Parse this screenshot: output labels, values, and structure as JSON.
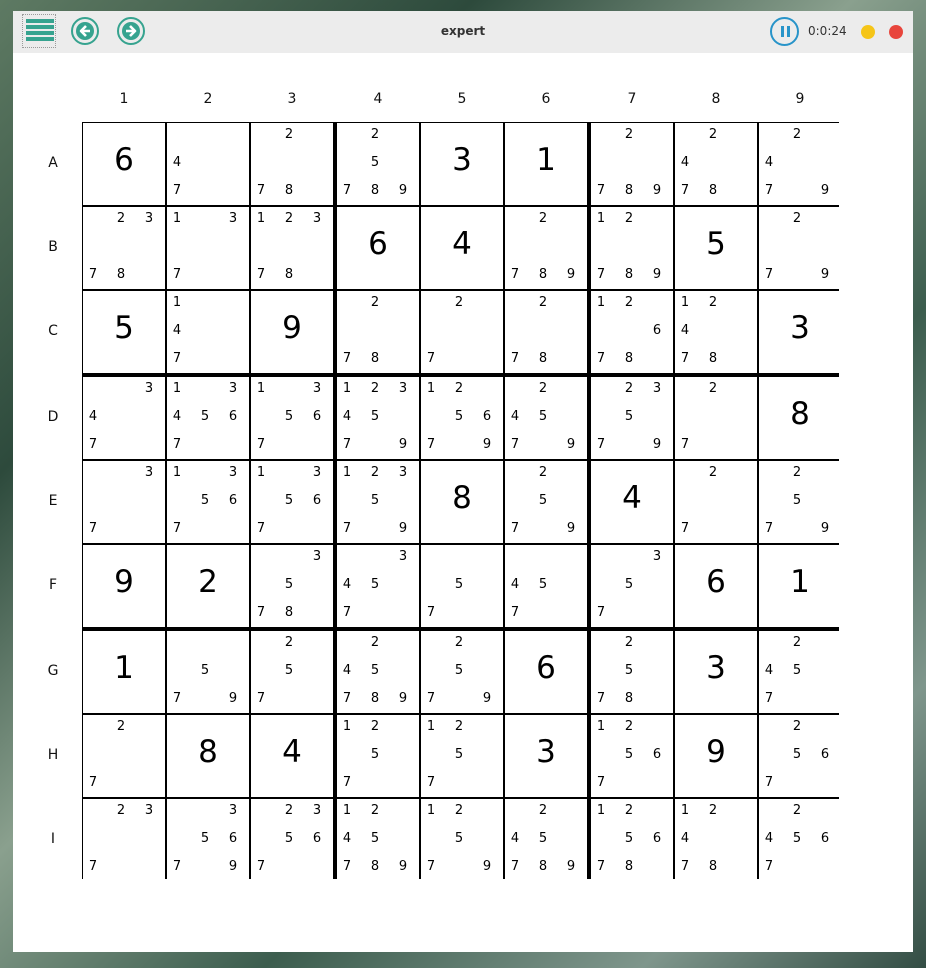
{
  "title": "expert",
  "timer": "0:0:24",
  "colors": {
    "accent": "#36a38f",
    "pause": "#2894c9",
    "minimize": "#f5c518",
    "close": "#e8453c"
  },
  "toolbar": {
    "menu_icon": "hamburger-icon",
    "back_icon": "arrow-left-icon",
    "forward_icon": "arrow-right-icon",
    "pause_icon": "pause-icon"
  },
  "columns": [
    "1",
    "2",
    "3",
    "4",
    "5",
    "6",
    "7",
    "8",
    "9"
  ],
  "rows": [
    "A",
    "B",
    "C",
    "D",
    "E",
    "F",
    "G",
    "H",
    "I"
  ],
  "board": [
    [
      "6",
      [
        4,
        7
      ],
      [
        2,
        7,
        8
      ],
      [
        2,
        5,
        7,
        8,
        9
      ],
      "3",
      "1",
      [
        2,
        7,
        8,
        9
      ],
      [
        2,
        4,
        7,
        8
      ],
      [
        2,
        4,
        7,
        9
      ]
    ],
    [
      [
        2,
        3,
        7,
        8
      ],
      [
        1,
        3,
        7
      ],
      [
        1,
        2,
        3,
        7,
        8
      ],
      "6",
      "4",
      [
        2,
        7,
        8,
        9
      ],
      [
        1,
        2,
        7,
        8,
        9
      ],
      "5",
      [
        2,
        7,
        9
      ]
    ],
    [
      "5",
      [
        1,
        4,
        7
      ],
      "9",
      [
        2,
        7,
        8
      ],
      [
        2,
        7
      ],
      [
        2,
        7,
        8
      ],
      [
        1,
        2,
        6,
        7,
        8
      ],
      [
        1,
        2,
        4,
        7,
        8
      ],
      "3"
    ],
    [
      [
        3,
        4,
        7
      ],
      [
        1,
        3,
        4,
        5,
        6,
        7
      ],
      [
        1,
        3,
        5,
        6,
        7
      ],
      [
        1,
        2,
        3,
        4,
        5,
        7,
        9
      ],
      [
        1,
        2,
        5,
        6,
        7,
        9
      ],
      [
        2,
        4,
        5,
        7,
        9
      ],
      [
        2,
        3,
        5,
        7,
        9
      ],
      [
        2,
        7
      ],
      "8"
    ],
    [
      [
        3,
        7
      ],
      [
        1,
        3,
        5,
        6,
        7
      ],
      [
        1,
        3,
        5,
        6,
        7
      ],
      [
        1,
        2,
        3,
        5,
        7,
        9
      ],
      "8",
      [
        2,
        5,
        7,
        9
      ],
      "4",
      [
        2,
        7
      ],
      [
        2,
        5,
        7,
        9
      ]
    ],
    [
      "9",
      "2",
      [
        3,
        5,
        7,
        8
      ],
      [
        3,
        4,
        5,
        7
      ],
      [
        5,
        7
      ],
      [
        4,
        5,
        7
      ],
      [
        3,
        5,
        7
      ],
      "6",
      "1"
    ],
    [
      "1",
      [
        5,
        7,
        9
      ],
      [
        2,
        5,
        7
      ],
      [
        2,
        4,
        5,
        7,
        8,
        9
      ],
      [
        2,
        5,
        7,
        9
      ],
      "6",
      [
        2,
        5,
        7,
        8
      ],
      "3",
      [
        2,
        4,
        5,
        7
      ]
    ],
    [
      [
        2,
        7
      ],
      "8",
      "4",
      [
        1,
        2,
        5,
        7
      ],
      [
        1,
        2,
        5,
        7
      ],
      "3",
      [
        1,
        2,
        5,
        6,
        7
      ],
      "9",
      [
        2,
        5,
        6,
        7
      ]
    ],
    [
      [
        2,
        3,
        7
      ],
      [
        3,
        5,
        6,
        7,
        9
      ],
      [
        2,
        3,
        5,
        6,
        7
      ],
      [
        1,
        2,
        4,
        5,
        7,
        8,
        9
      ],
      [
        1,
        2,
        5,
        7,
        9
      ],
      [
        2,
        4,
        5,
        7,
        8,
        9
      ],
      [
        1,
        2,
        5,
        6,
        7,
        8
      ],
      [
        1,
        2,
        4,
        7,
        8
      ],
      [
        2,
        4,
        5,
        6,
        7
      ]
    ]
  ]
}
